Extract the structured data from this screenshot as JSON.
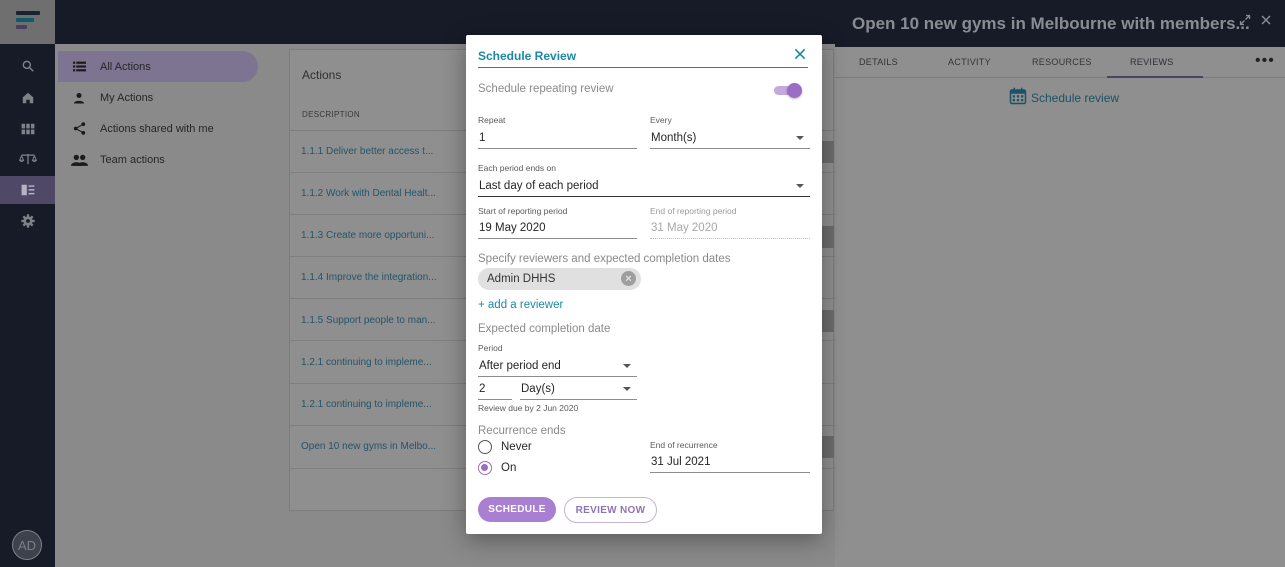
{
  "rail": {
    "avatar_initials": "AD"
  },
  "nav": {
    "items": [
      {
        "label": "All Actions"
      },
      {
        "label": "My Actions"
      },
      {
        "label": "Actions shared with me"
      },
      {
        "label": "Team actions"
      }
    ]
  },
  "actions": {
    "title": "Actions",
    "column_header": "DESCRIPTION",
    "rows": [
      "1.1.1 Deliver better access t...",
      "1.1.2 Work with Dental Healt...",
      "1.1.3 Create more opportuni...",
      "1.1.4 Improve the integration...",
      "1.1.5 Support people to man...",
      "1.2.1 continuing to impleme...",
      "1.2.1 continuing to impleme...",
      "Open 10 new gyms in Melbo..."
    ]
  },
  "detail": {
    "title": "Open 10 new gyms in Melbourne with members...",
    "tabs": [
      "DETAILS",
      "ACTIVITY",
      "RESOURCES",
      "REVIEWS"
    ],
    "schedule_link": "Schedule review"
  },
  "modal": {
    "title": "Schedule Review",
    "repeat_toggle_label": "Schedule repeating review",
    "repeat_toggle_on": true,
    "repeat_label": "Repeat",
    "repeat_value": "1",
    "every_label": "Every",
    "every_value": "Month(s)",
    "period_ends_label": "Each period ends on",
    "period_ends_value": "Last day of each period",
    "start_label": "Start of reporting period",
    "start_value": "19 May 2020",
    "end_label": "End of reporting period",
    "end_value": "31 May 2020",
    "reviewers_label": "Specify reviewers and expected completion dates",
    "reviewer_chip": "Admin DHHS",
    "add_reviewer": "+ add a reviewer",
    "completion_label": "Expected completion date",
    "period_label": "Period",
    "period_value": "After period end",
    "count_value": "2",
    "unit_value": "Day(s)",
    "review_due": "Review due by 2 Jun 2020",
    "recurrence_label": "Recurrence ends",
    "never_label": "Never",
    "on_label": "On",
    "end_recurrence_label": "End of recurrence",
    "end_recurrence_value": "31 Jul 2021",
    "schedule_button": "SCHEDULE",
    "review_now_button": "REVIEW NOW",
    "colors": {
      "accent": "#1a8aa5",
      "primary": "#a97fd2"
    }
  }
}
